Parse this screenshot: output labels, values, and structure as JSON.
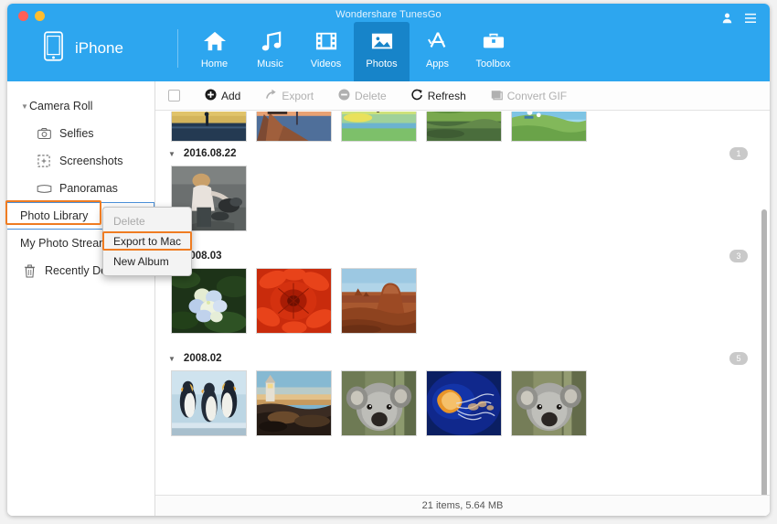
{
  "window": {
    "title": "Wondershare TunesGo",
    "controls": [
      "close",
      "minimize"
    ]
  },
  "header": {
    "device_label": "iPhone",
    "device_icon": "iphone-icon",
    "account_icon": "user-icon",
    "menu_icon": "hamburger-menu-icon",
    "nav": [
      {
        "label": "Home",
        "icon": "home-icon",
        "active": false
      },
      {
        "label": "Music",
        "icon": "music-icon",
        "active": false
      },
      {
        "label": "Videos",
        "icon": "video-icon",
        "active": false
      },
      {
        "label": "Photos",
        "icon": "photo-icon",
        "active": true
      },
      {
        "label": "Apps",
        "icon": "apps-icon",
        "active": false
      },
      {
        "label": "Toolbox",
        "icon": "toolbox-icon",
        "active": false
      }
    ],
    "accent_color": "#2da6ef",
    "active_tab_color": "#1784c9"
  },
  "sidebar": {
    "items": [
      {
        "label": "Camera Roll",
        "icon": "disclosure-triangle",
        "level": "root",
        "selected": false
      },
      {
        "label": "Selfies",
        "icon": "camera-icon",
        "level": "child",
        "selected": false
      },
      {
        "label": "Screenshots",
        "icon": "screenshot-icon",
        "level": "child",
        "selected": false
      },
      {
        "label": "Panoramas",
        "icon": "panorama-icon",
        "level": "child",
        "selected": false
      },
      {
        "label": "Photo Library",
        "icon": "none",
        "level": "plain",
        "selected": true
      },
      {
        "label": "My Photo Stream",
        "icon": "none",
        "level": "plain",
        "selected": false
      },
      {
        "label": "Recently Deleted",
        "icon": "trash-icon",
        "level": "plain",
        "selected": false
      }
    ]
  },
  "toolbar": {
    "select_all_checked": false,
    "buttons": [
      {
        "label": "Add",
        "icon": "plus-circle-icon",
        "enabled": true
      },
      {
        "label": "Export",
        "icon": "export-arrow-icon",
        "enabled": false
      },
      {
        "label": "Delete",
        "icon": "minus-circle-icon",
        "enabled": false
      },
      {
        "label": "Refresh",
        "icon": "refresh-icon",
        "enabled": true
      },
      {
        "label": "Convert GIF",
        "icon": "gif-icon",
        "enabled": false
      }
    ]
  },
  "context_menu": {
    "items": [
      {
        "label": "Delete",
        "enabled": false,
        "highlighted": false
      },
      {
        "label": "Export to Mac",
        "enabled": true,
        "highlighted": true
      },
      {
        "label": "New Album",
        "enabled": true,
        "highlighted": false
      }
    ],
    "highlight_color": "#ef7c22"
  },
  "groups": [
    {
      "date": "2016.08.22",
      "count": "1",
      "partial_top_row": true,
      "top_thumbs": [
        "mountain-lake-photo",
        "pier-sunset-photo",
        "tree-field-photo",
        "green-pond-photo",
        "seaside-photo"
      ],
      "thumbs": [
        "child-dog-beach-photo"
      ]
    },
    {
      "date": "2008.03",
      "count": "3",
      "thumbs": [
        "hydrangea-photo",
        "red-dahlia-photo",
        "desert-butte-photo"
      ]
    },
    {
      "date": "2008.02",
      "count": "5",
      "thumbs": [
        "penguins-photo",
        "lighthouse-dusk-photo",
        "koala-photo",
        "jellyfish-photo",
        "koala-2-photo"
      ]
    }
  ],
  "status": {
    "summary": "21 items, 5.64 MB"
  }
}
